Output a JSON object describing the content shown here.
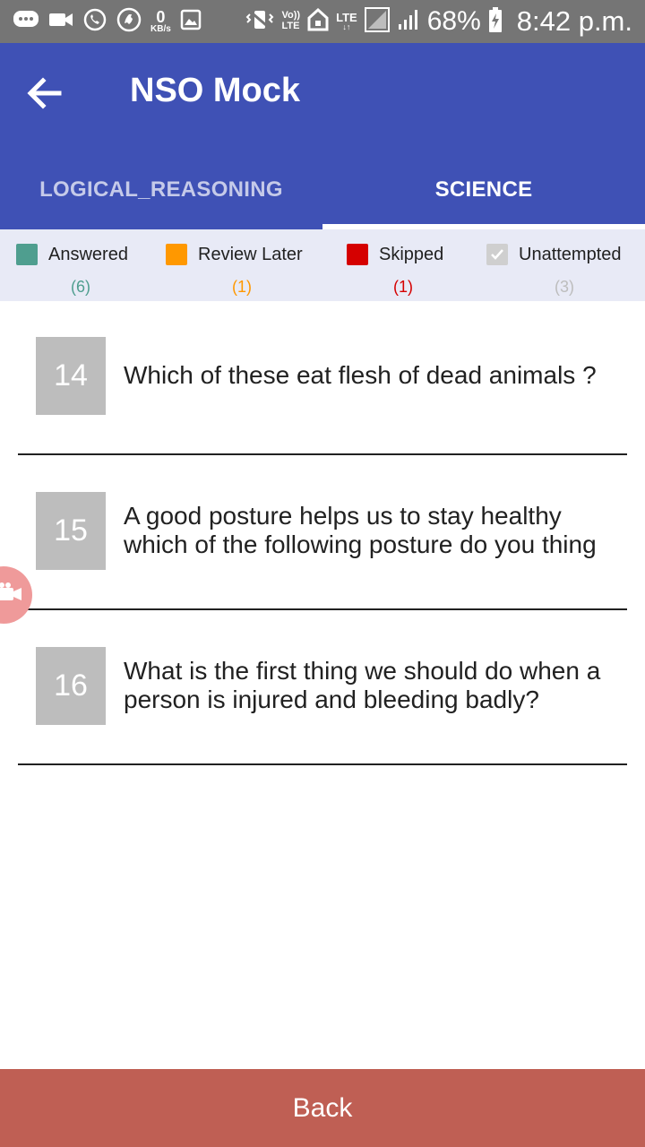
{
  "status_bar": {
    "network_speed_value": "0",
    "network_speed_unit": "KB/s",
    "volte_top": "Vo))",
    "volte_bottom": "LTE",
    "lte_label": "LTE",
    "battery_percent": "68%",
    "time": "8:42 p.m."
  },
  "app_bar": {
    "title": "NSO Mock"
  },
  "tabs": [
    {
      "label": "LOGICAL_REASONING",
      "active": false
    },
    {
      "label": "SCIENCE",
      "active": true
    }
  ],
  "legend": [
    {
      "label": "Answered",
      "count": "(6)",
      "color": "#4f9e8f"
    },
    {
      "label": "Review Later",
      "count": "(1)",
      "color": "#ff9800"
    },
    {
      "label": "Skipped",
      "count": "(1)",
      "color": "#d50000"
    },
    {
      "label": "Unattempted",
      "count": "(3)",
      "color": "#bdbdbd"
    }
  ],
  "questions": [
    {
      "number": "14",
      "text": "Which of these eat flesh of dead animals ?"
    },
    {
      "number": "15",
      "text": "A good posture helps us to stay healthy which of the following posture do you thing"
    },
    {
      "number": "16",
      "text": "What is the first thing we should do when a person is injured and bleeding badly?"
    }
  ],
  "footer": {
    "back_label": "Back"
  }
}
